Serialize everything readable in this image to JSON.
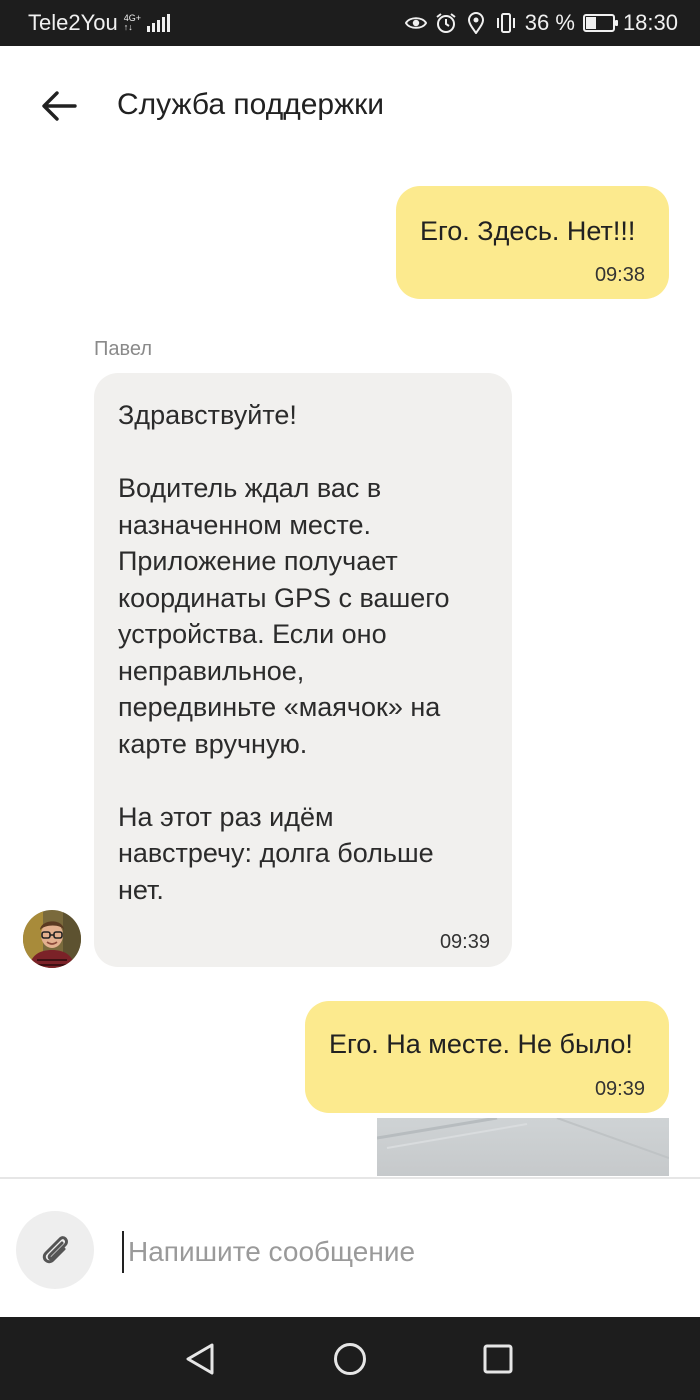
{
  "status_bar": {
    "carrier": "Tele2You",
    "network_top": "4G+",
    "network_bottom": "↑↓",
    "battery_percent": "36 %",
    "battery_level": 0.36,
    "time": "18:30",
    "icons": [
      "eye-icon",
      "alarm-icon",
      "location-icon",
      "vibrate-icon",
      "battery-icon"
    ]
  },
  "header": {
    "title": "Служба поддержки"
  },
  "messages": [
    {
      "direction": "outgoing",
      "text": "Его. Здесь. Нет!!!",
      "time": "09:38"
    },
    {
      "direction": "incoming",
      "sender": "Павел",
      "text": "Здравствуйте!\n\nВодитель ждал вас в\nназначенном месте.\nПриложение получает\nкоординаты GPS с вашего\nустройства. Если оно\nнеправильное,\nпередвиньте «маячок» на\nкарте вручную.\n\nНа этот раз идём\nнавстречу: долга больше\nнет.",
      "time": "09:39"
    },
    {
      "direction": "outgoing",
      "text": "Его. На месте. Не было!",
      "time": "09:39"
    }
  ],
  "composer": {
    "placeholder": "Напишите сообщение"
  },
  "colors": {
    "outgoing_bubble": "#fcea8e",
    "incoming_bubble": "#f1f0ee",
    "bars": "#1d1d1d"
  }
}
